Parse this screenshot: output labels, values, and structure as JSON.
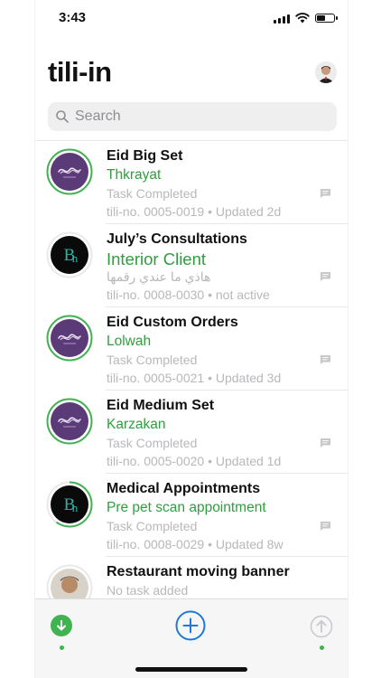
{
  "status_bar": {
    "time": "3:43"
  },
  "header": {
    "title": "tili-in"
  },
  "search": {
    "placeholder": "Search"
  },
  "items": [
    {
      "title": "Eid Big Set",
      "subtitle": "Thkrayat",
      "status": "Task Completed",
      "meta": "tili-no. 0005-0019  •  Updated 2d",
      "avatar": "purple-logo",
      "progress": 1.0
    },
    {
      "title": "July’s Consultations",
      "subtitle": "Interior Client",
      "status": "هاذي ما عندي رقمها",
      "meta": "tili-no. 0008-0030  •  not active",
      "avatar": "black-bn-logo",
      "progress": 0.0
    },
    {
      "title": "Eid Custom Orders",
      "subtitle": "Lolwah",
      "status": "Task Completed",
      "meta": "tili-no. 0005-0021  •  Updated 3d",
      "avatar": "purple-logo",
      "progress": 1.0
    },
    {
      "title": "Eid Medium Set",
      "subtitle": "Karzakan",
      "status": "Task Completed",
      "meta": "tili-no. 0005-0020  •  Updated 1d",
      "avatar": "purple-logo",
      "progress": 1.0
    },
    {
      "title": "Medical Appointments",
      "subtitle": "Pre pet scan appointment",
      "status": "Task Completed",
      "meta": "tili-no. 0008-0029  •  Updated 8w",
      "avatar": "black-bn-logo",
      "progress": 0.6
    },
    {
      "title": "Restaurant moving banner",
      "subtitle": "",
      "status": "No task added",
      "meta": "",
      "avatar": "person-photo",
      "progress": 0.0
    }
  ],
  "colors": {
    "accent_green": "#3fb34f",
    "subtitle_green": "#2f9e3e",
    "add_blue": "#1f7ad6"
  },
  "icons": {
    "left": "download-arrow-icon",
    "center": "add-circle-icon",
    "right": "upload-arrow-icon",
    "row": "chat-icon"
  }
}
